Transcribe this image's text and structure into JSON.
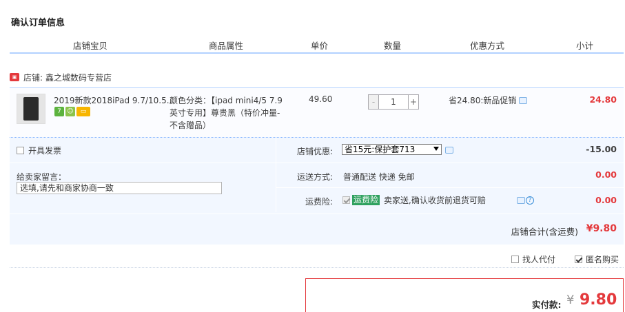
{
  "title": "确认订单信息",
  "columns": [
    "店铺宝贝",
    "商品属性",
    "单价",
    "数量",
    "优惠方式",
    "小计"
  ],
  "shop": {
    "label": "店铺:",
    "name": "鑫之城数码专营店",
    "icon": "store-icon"
  },
  "item": {
    "title": "2019新款2018iPad 9.7/10.5...",
    "attr_lines": [
      "颜色分类：【ipad mini4/5 7.9",
      "英寸专用】尊贵黑（特价冲量-",
      "不含赠品）"
    ],
    "price": "49.60",
    "qty_minus": "-",
    "qty_value": "1",
    "qty_plus": "+",
    "promo": "省24.80:新品促销",
    "subtotal": "24.80",
    "badges": [
      {
        "text": "7",
        "color": "#5cb33e"
      },
      {
        "text": "",
        "color": "#8bc34a"
      },
      {
        "text": "",
        "color": "#f7b500"
      }
    ]
  },
  "invoice": {
    "label": "开具发票"
  },
  "message": {
    "label": "给卖家留言：",
    "value": "选填,请先和商家协商一致"
  },
  "shop_discount": {
    "label": "店铺优惠:",
    "selected": "省15元:保护套713",
    "value": "-15.00"
  },
  "shipping": {
    "label": "运送方式:",
    "value": "普通配送 快递 免邮",
    "amount": "0.00"
  },
  "insurance": {
    "label": "运费险:",
    "tag": "运费险",
    "text": "卖家送,确认收货前退货可赔",
    "amount": "0.00",
    "help": "?"
  },
  "shop_total": {
    "label": "店铺合计(含运费)",
    "value": "¥9.80"
  },
  "options": {
    "agent_pay": "找人代付",
    "anonymous": "匿名购买"
  },
  "pay": {
    "label": "实付款:",
    "currency": "¥",
    "value": "9.80"
  },
  "colors": {
    "accent_red": "#e4393c",
    "border_blue": "#b2d1ff",
    "row_bg": "#f2f7ff"
  }
}
